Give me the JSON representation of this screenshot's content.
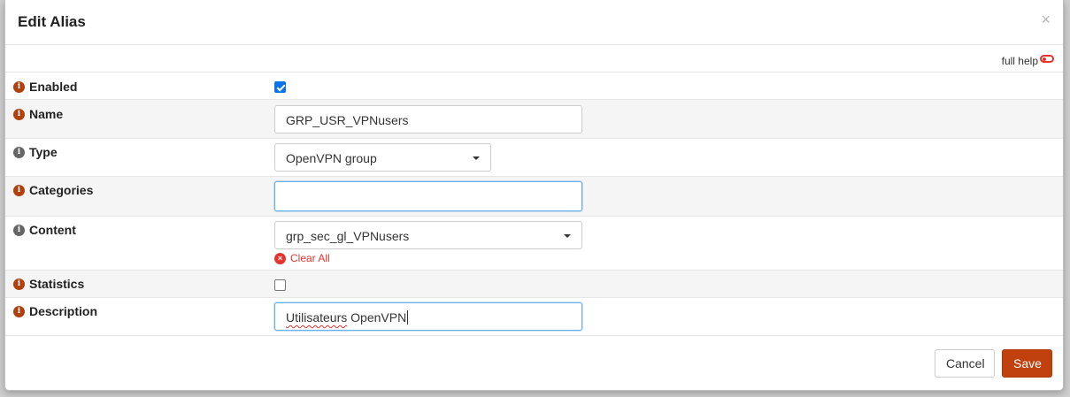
{
  "modal": {
    "title": "Edit Alias",
    "close_symbol": "×",
    "full_help_label": "full help"
  },
  "fields": {
    "enabled": {
      "label": "Enabled",
      "checked": true
    },
    "name": {
      "label": "Name",
      "value": "GRP_USR_VPNusers"
    },
    "type": {
      "label": "Type",
      "value": "OpenVPN group"
    },
    "categories": {
      "label": "Categories",
      "value": ""
    },
    "content": {
      "label": "Content",
      "value": "grp_sec_gl_VPNusers",
      "clear_label": "Clear All"
    },
    "statistics": {
      "label": "Statistics",
      "checked": false
    },
    "description": {
      "label": "Description",
      "value_word1": "Utilisateurs",
      "value_word2": " OpenVPN"
    }
  },
  "buttons": {
    "cancel_label": "Cancel",
    "save_label": "Save"
  },
  "icons": {
    "info": "info-icon",
    "close": "close-icon",
    "toggle": "toggle-off-icon",
    "caret": "caret-down-icon",
    "clear": "times-circle-icon"
  },
  "colors": {
    "accent": "#c0400e",
    "info_icon": "#b0400e",
    "info_icon_gray": "#666666",
    "danger": "#e3342f",
    "checkbox": "#0a74e8"
  }
}
